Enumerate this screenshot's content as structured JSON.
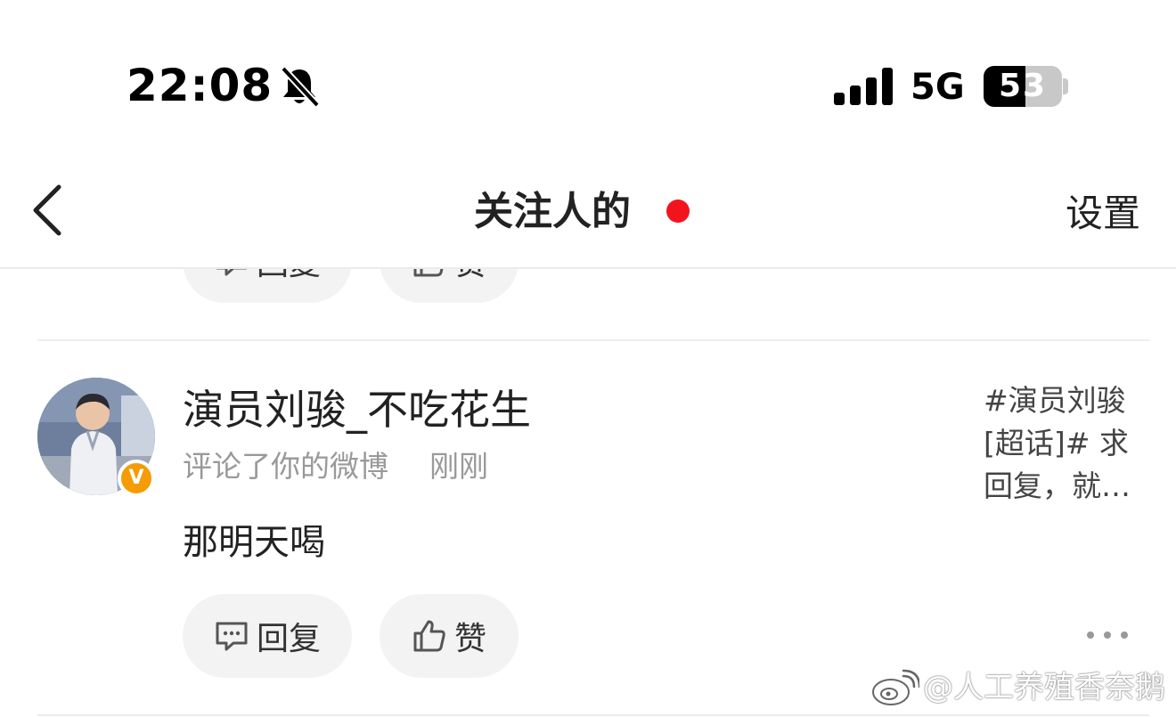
{
  "status_bar": {
    "time": "22:08",
    "network": "5G",
    "battery_percent": 53,
    "battery_label": "53"
  },
  "nav": {
    "title": "关注人的",
    "settings_label": "设置"
  },
  "previous_item": {
    "reply_label": "回复",
    "like_label": "赞"
  },
  "notification": {
    "username": "演员刘骏_不吃花生",
    "action": "评论了你的微博",
    "time": "刚刚",
    "comment": "那明天喝",
    "verified_badge": "V",
    "post_preview_lines": [
      "#演员刘骏",
      "[超话]# 求",
      "回复，就…"
    ],
    "reply_label": "回复",
    "like_label": "赞"
  },
  "watermark": "@人工养殖香奈鹅",
  "colors": {
    "dot_red": "#f2141c",
    "badge_orange": "#f59b05",
    "secondary_text": "#999999"
  }
}
